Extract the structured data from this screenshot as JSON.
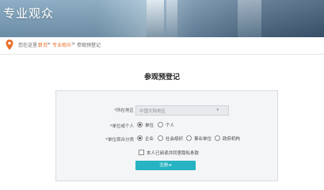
{
  "banner": {
    "title": "专业观众"
  },
  "breadcrumb": {
    "prefix": "您在这里：",
    "items": [
      "首页",
      "专业观众",
      "参观预登记"
    ],
    "separator": ">"
  },
  "page_title": "参观预登记",
  "form": {
    "region": {
      "label": "*所在地区",
      "value": "中国大陆地区"
    },
    "entity": {
      "label": "*单位或个人",
      "options": [
        "单位",
        "个人"
      ],
      "selected": 0
    },
    "category": {
      "label": "*单位观众分类",
      "options": [
        "企业",
        "社会组织",
        "事业单位",
        "政府机构"
      ],
      "selected": 0
    },
    "consent_text": "本人已阅读并同意隐私条款",
    "submit_label": "注册",
    "submit_icon": "arrow-icon"
  },
  "colors": {
    "accent": "#e96e27",
    "button": "#27b3c2"
  }
}
